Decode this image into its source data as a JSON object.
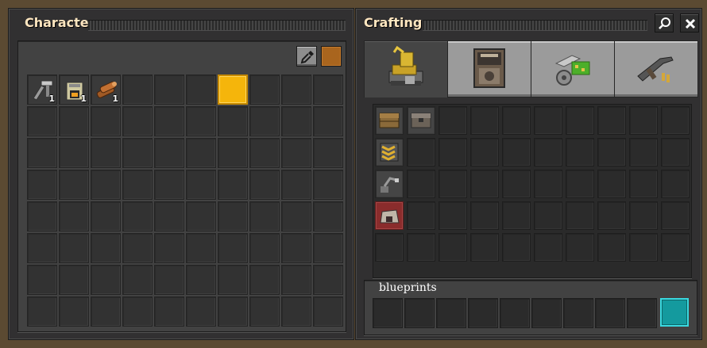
{
  "character": {
    "title": "Character",
    "color_picker_icon": "eyedropper-icon",
    "color_swatch": "#a9651e",
    "inventory": {
      "rows": 8,
      "cols": 10,
      "items": [
        {
          "slot": 0,
          "icon": "mining-drill-icon",
          "count": "1"
        },
        {
          "slot": 1,
          "icon": "burner-furnace-icon",
          "count": "1"
        },
        {
          "slot": 2,
          "icon": "wood-icon",
          "count": "1"
        }
      ],
      "selected_slot": 6
    }
  },
  "crafting": {
    "title": "Crafting",
    "search_icon": "search-icon",
    "close_icon": "close-icon",
    "tabs": [
      {
        "name": "logistics",
        "icon": "logistics-icon",
        "active": true
      },
      {
        "name": "production",
        "icon": "production-icon",
        "active": false
      },
      {
        "name": "intermediate-products",
        "icon": "intermediate-products-icon",
        "active": false
      },
      {
        "name": "combat",
        "icon": "combat-icon",
        "active": false
      }
    ],
    "recipes": [
      {
        "row": 0,
        "col": 0,
        "icon": "wooden-chest-icon"
      },
      {
        "row": 0,
        "col": 1,
        "icon": "iron-chest-icon"
      },
      {
        "row": 1,
        "col": 0,
        "icon": "transport-belt-icon"
      },
      {
        "row": 2,
        "col": 0,
        "icon": "burner-inserter-icon"
      },
      {
        "row": 3,
        "col": 0,
        "icon": "stone-furnace-icon",
        "unavailable": true
      }
    ],
    "blueprints_label": "blueprints",
    "accent_cyan": "#149a9e",
    "accent_orange": "#f5b50b"
  }
}
